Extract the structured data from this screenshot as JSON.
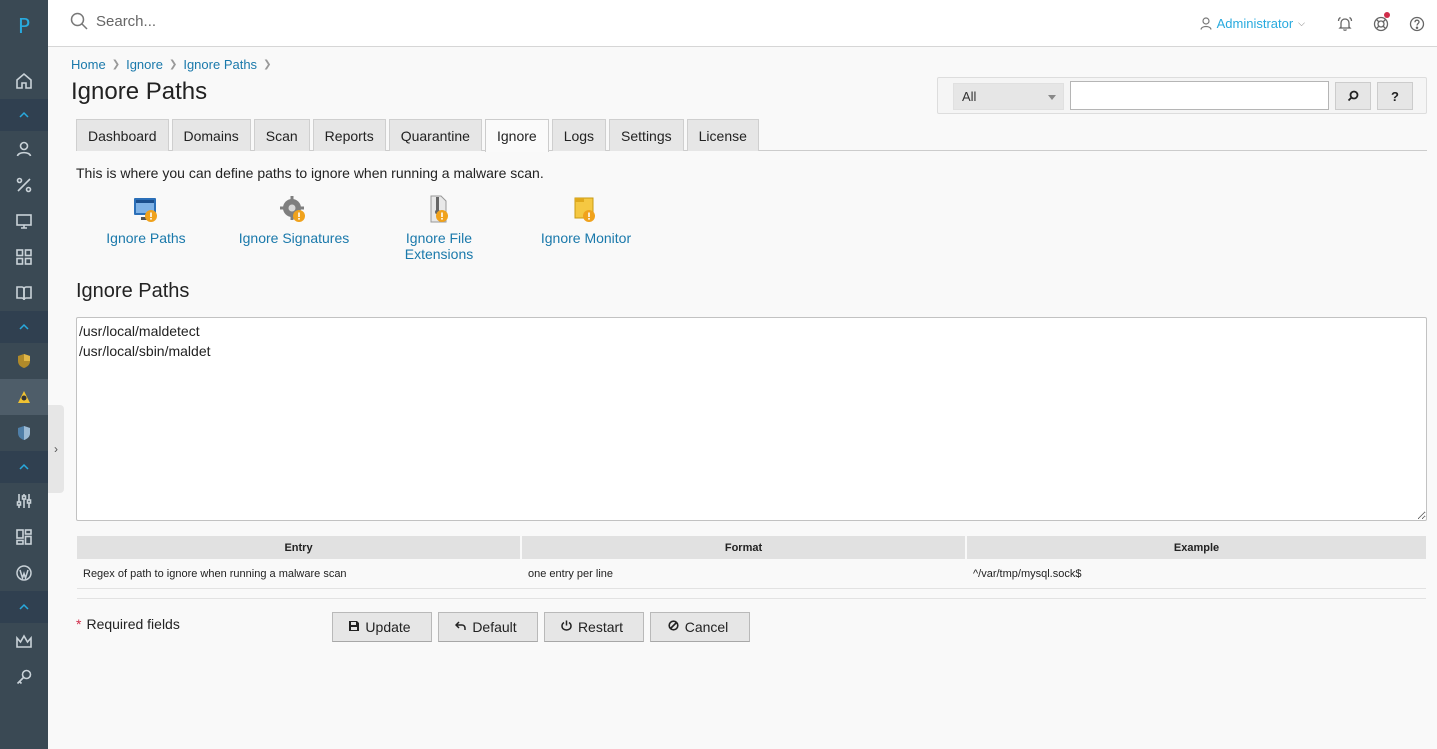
{
  "rail": {
    "logo": "P"
  },
  "topbar": {
    "search_placeholder": "Search...",
    "user": "Administrator"
  },
  "breadcrumbs": [
    "Home",
    "Ignore",
    "Ignore Paths"
  ],
  "page_title": "Ignore Paths",
  "filter": {
    "select_value": "All",
    "search_value": "",
    "help_label": "?"
  },
  "tabs": [
    "Dashboard",
    "Domains",
    "Scan",
    "Reports",
    "Quarantine",
    "Ignore",
    "Logs",
    "Settings",
    "License"
  ],
  "active_tab": "Ignore",
  "intro": "This is where you can define paths to ignore when running a malware scan.",
  "shortcuts": [
    {
      "line1": "Ignore Paths",
      "line2": "",
      "icon": "ignore-paths-icon"
    },
    {
      "line1": "Ignore Signatures",
      "line2": "",
      "icon": "ignore-signatures-icon"
    },
    {
      "line1": "Ignore File",
      "line2": "Extensions",
      "icon": "ignore-file-extensions-icon"
    },
    {
      "line1": "Ignore Monitor",
      "line2": "",
      "icon": "ignore-monitor-icon"
    }
  ],
  "section_title": "Ignore Paths",
  "paths_text": "/usr/local/maldetect\n/usr/local/sbin/maldet",
  "info_table": {
    "headers": [
      "Entry",
      "Format",
      "Example"
    ],
    "row": [
      "Regex of path to ignore when running a malware scan",
      "one entry per line",
      "^/var/tmp/mysql.sock$"
    ]
  },
  "required_note": "Required fields",
  "required_mark": "*",
  "buttons": {
    "update": "Update",
    "default": "Default",
    "restart": "Restart",
    "cancel": "Cancel"
  },
  "colors": {
    "rail": "#3a4954",
    "link": "#1a79ab",
    "accent": "#28aade",
    "alert": "#d02d4a"
  }
}
